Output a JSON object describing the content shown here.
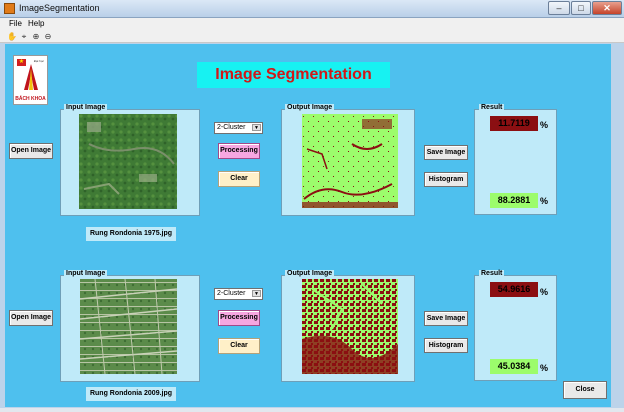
{
  "window": {
    "title": "ImageSegmentation",
    "minimize": "–",
    "maximize": "□",
    "close": "✕"
  },
  "menu": [
    "File",
    "Help"
  ],
  "toolbar_icons": [
    "hand-pan-icon",
    "data-cursor-icon",
    "zoom-in-icon",
    "zoom-out-icon"
  ],
  "logo": {
    "text": "BÁCH KHOA",
    "subtext": "Đại học"
  },
  "app_title": "Image Segmentation",
  "rows": [
    {
      "open_button": "Open Image",
      "input_label": "Input Image",
      "cluster_select": "2-Cluster",
      "processing_button": "Processing",
      "clear_button": "Clear",
      "output_label": "Output Image",
      "save_button": "Save Image",
      "histogram_button": "Histogram",
      "result_label": "Result",
      "result_top": "11.7119",
      "result_bottom": "88.2881",
      "percent": "%",
      "filename": "Rung Rondonia 1975.jpg"
    },
    {
      "open_button": "Open Image",
      "input_label": "Input Image",
      "cluster_select": "2-Cluster",
      "processing_button": "Processing",
      "clear_button": "Clear",
      "output_label": "Output Image",
      "save_button": "Save Image",
      "histogram_button": "Histogram",
      "result_label": "Result",
      "result_top": "54.9616",
      "result_bottom": "45.0384",
      "percent": "%",
      "filename": "Rung Rondonia 2009.jpg"
    }
  ],
  "close_button": "Close",
  "colors": {
    "background": "#4ec0ee",
    "cluster_dark": "#8b0f12",
    "cluster_light": "#9cfc6c",
    "title_bg": "#17f2f2",
    "title_text": "#d11818"
  }
}
